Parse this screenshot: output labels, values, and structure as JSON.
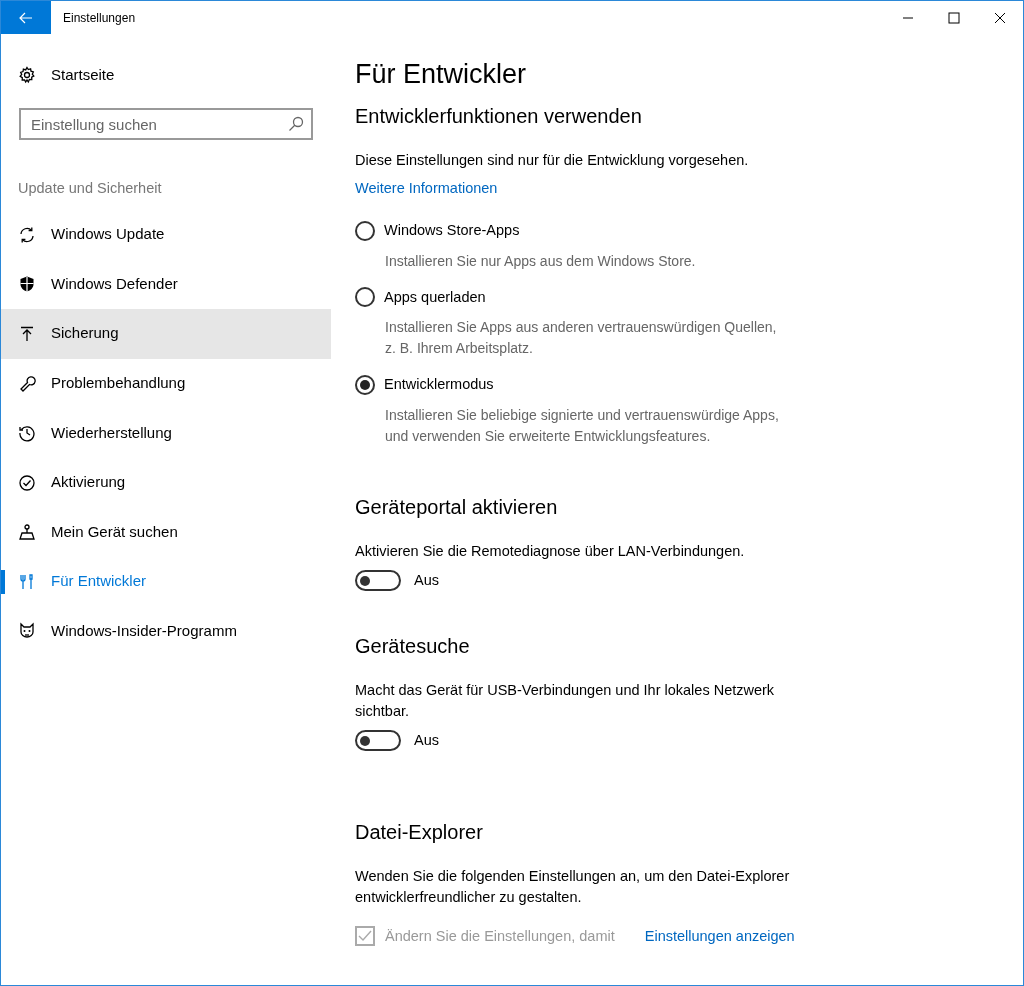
{
  "window": {
    "title": "Einstellungen"
  },
  "sidebar": {
    "home": "Startseite",
    "search": {
      "placeholder": "Einstellung suchen"
    },
    "section": "Update und Sicherheit",
    "items": [
      {
        "label": "Windows Update",
        "kind": "sync",
        "selected": false,
        "highlighted": false
      },
      {
        "label": "Windows Defender",
        "kind": "shield",
        "selected": false,
        "highlighted": false
      },
      {
        "label": "Sicherung",
        "kind": "upload",
        "selected": false,
        "highlighted": true
      },
      {
        "label": "Problembehandlung",
        "kind": "wrench",
        "selected": false,
        "highlighted": false
      },
      {
        "label": "Wiederherstellung",
        "kind": "history",
        "selected": false,
        "highlighted": false
      },
      {
        "label": "Aktivierung",
        "kind": "check",
        "selected": false,
        "highlighted": false
      },
      {
        "label": "Mein Gerät suchen",
        "kind": "person",
        "selected": false,
        "highlighted": false
      },
      {
        "label": "Für Entwickler",
        "kind": "tools",
        "selected": true,
        "highlighted": false
      },
      {
        "label": "Windows-Insider-Programm",
        "kind": "cat",
        "selected": false,
        "highlighted": false
      }
    ]
  },
  "page": {
    "title": "Für Entwickler",
    "dev_features": {
      "heading": "Entwicklerfunktionen verwenden",
      "text": "Diese Einstellungen sind nur für die Entwicklung vorgesehen.",
      "link": "Weitere Informationen",
      "options": [
        {
          "label": "Windows Store-Apps",
          "description": "Installieren Sie nur Apps aus dem Windows Store.",
          "selected": false
        },
        {
          "label": "Apps querladen",
          "description": "Installieren Sie Apps aus anderen vertrauenswürdigen Quellen, z. B. Ihrem Arbeitsplatz.",
          "selected": false
        },
        {
          "label": "Entwicklermodus",
          "description": "Installieren Sie beliebige signierte und vertrauenswürdige Apps, und verwenden Sie erweiterte Entwicklungsfeatures.",
          "selected": true
        }
      ]
    },
    "device_portal": {
      "heading": "Geräteportal aktivieren",
      "text": "Aktivieren Sie die Remotediagnose über LAN-Verbindungen.",
      "toggle": {
        "on": false,
        "label": "Aus"
      }
    },
    "device_discovery": {
      "heading": "Gerätesuche",
      "text": "Macht das Gerät für USB-Verbindungen und Ihr lokales Netzwerk sichtbar.",
      "toggle": {
        "on": false,
        "label": "Aus"
      }
    },
    "file_explorer": {
      "heading": "Datei-Explorer",
      "text": "Wenden Sie die folgenden Einstellungen an, um den Datei-Explorer entwicklerfreundlicher zu gestalten.",
      "checkbox": {
        "label": "Ändern Sie die Einstellungen, damit",
        "checked": true,
        "disabled": true
      },
      "link": "Einstellungen anzeigen"
    }
  }
}
